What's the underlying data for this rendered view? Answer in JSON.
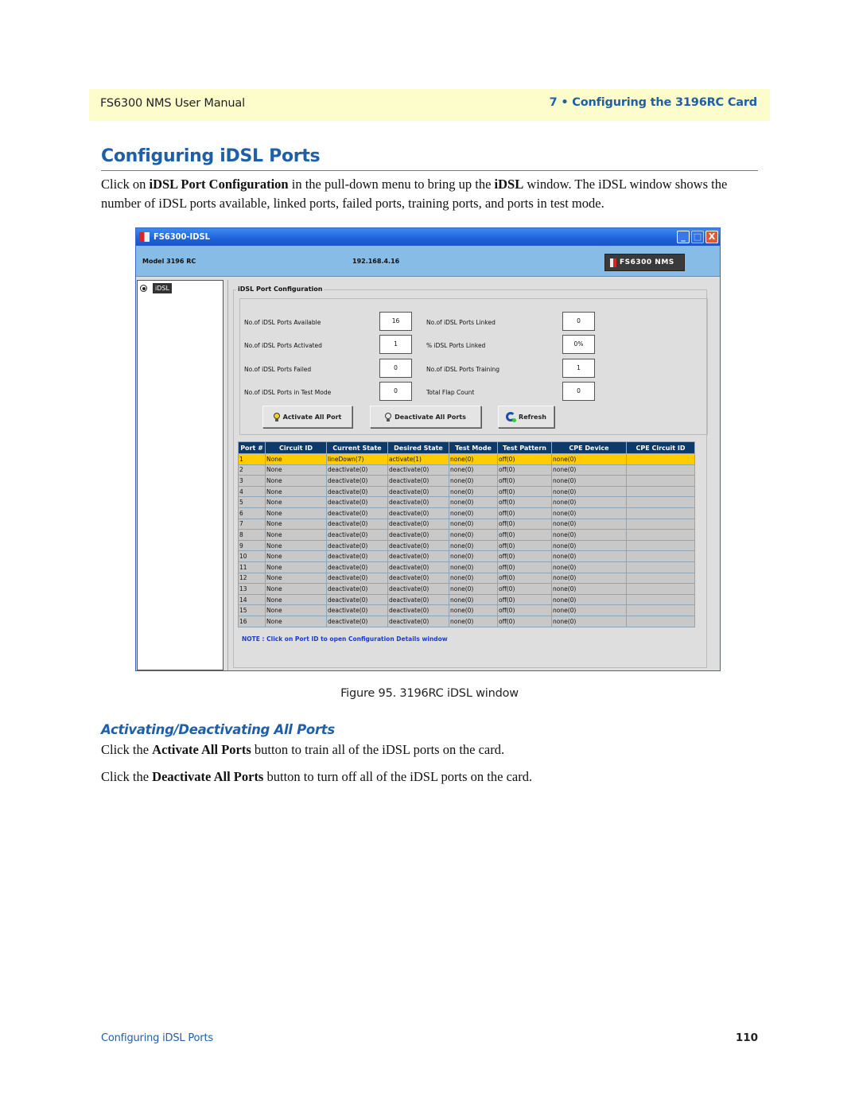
{
  "running_header": {
    "left": "FS6300 NMS User Manual",
    "right": "7 • Configuring the 3196RC Card"
  },
  "section": {
    "title": "Configuring iDSL Ports",
    "intro": {
      "t1": "Click on ",
      "b1": "iDSL Port Configuration",
      "t2": " in the pull-down menu to bring up the ",
      "b2": "iDSL",
      "t3": " window. The iDSL window shows the number of iDSL ports available, linked ports, failed ports, training ports, and ports in test mode."
    }
  },
  "window": {
    "title": "FS6300-IDSL",
    "controls": {
      "minimize": "_",
      "maximize": "□",
      "close": "X"
    },
    "info": {
      "model": "Model 3196 RC",
      "ip": "192.168.4.16",
      "brand": "FS6300 NMS"
    },
    "tree": {
      "node": "iDSL"
    },
    "group_title": "iDSL Port Configuration",
    "stats_left": [
      {
        "label": "No.of iDSL Ports Available",
        "value": "16"
      },
      {
        "label": "No.of iDSL Ports Activated",
        "value": "1"
      },
      {
        "label": "No.of iDSL Ports Failed",
        "value": "0"
      },
      {
        "label": "No.of iDSL Ports in Test Mode",
        "value": "0"
      }
    ],
    "stats_right": [
      {
        "label": "No.of iDSL Ports Linked",
        "value": "0"
      },
      {
        "label": "% iDSL Ports Linked",
        "value": "0%"
      },
      {
        "label": "No.of iDSL Ports Training",
        "value": "1"
      },
      {
        "label": "Total Flap Count",
        "value": "0"
      }
    ],
    "buttons": {
      "activate": "Activate All Port",
      "deactivate": "Deactivate All Ports",
      "refresh": "Refresh"
    },
    "table": {
      "columns": [
        "Port #",
        "Circuit ID",
        "Current State",
        "Desired State",
        "Test Mode",
        "Test Pattern",
        "CPE Device",
        "CPE Circuit ID"
      ],
      "rows": [
        [
          "1",
          "None",
          "lineDown(7)",
          "activate(1)",
          "none(0)",
          "off(0)",
          "none(0)",
          ""
        ],
        [
          "2",
          "None",
          "deactivate(0)",
          "deactivate(0)",
          "none(0)",
          "off(0)",
          "none(0)",
          ""
        ],
        [
          "3",
          "None",
          "deactivate(0)",
          "deactivate(0)",
          "none(0)",
          "off(0)",
          "none(0)",
          ""
        ],
        [
          "4",
          "None",
          "deactivate(0)",
          "deactivate(0)",
          "none(0)",
          "off(0)",
          "none(0)",
          ""
        ],
        [
          "5",
          "None",
          "deactivate(0)",
          "deactivate(0)",
          "none(0)",
          "off(0)",
          "none(0)",
          ""
        ],
        [
          "6",
          "None",
          "deactivate(0)",
          "deactivate(0)",
          "none(0)",
          "off(0)",
          "none(0)",
          ""
        ],
        [
          "7",
          "None",
          "deactivate(0)",
          "deactivate(0)",
          "none(0)",
          "off(0)",
          "none(0)",
          ""
        ],
        [
          "8",
          "None",
          "deactivate(0)",
          "deactivate(0)",
          "none(0)",
          "off(0)",
          "none(0)",
          ""
        ],
        [
          "9",
          "None",
          "deactivate(0)",
          "deactivate(0)",
          "none(0)",
          "off(0)",
          "none(0)",
          ""
        ],
        [
          "10",
          "None",
          "deactivate(0)",
          "deactivate(0)",
          "none(0)",
          "off(0)",
          "none(0)",
          ""
        ],
        [
          "11",
          "None",
          "deactivate(0)",
          "deactivate(0)",
          "none(0)",
          "off(0)",
          "none(0)",
          ""
        ],
        [
          "12",
          "None",
          "deactivate(0)",
          "deactivate(0)",
          "none(0)",
          "off(0)",
          "none(0)",
          ""
        ],
        [
          "13",
          "None",
          "deactivate(0)",
          "deactivate(0)",
          "none(0)",
          "off(0)",
          "none(0)",
          ""
        ],
        [
          "14",
          "None",
          "deactivate(0)",
          "deactivate(0)",
          "none(0)",
          "off(0)",
          "none(0)",
          ""
        ],
        [
          "15",
          "None",
          "deactivate(0)",
          "deactivate(0)",
          "none(0)",
          "off(0)",
          "none(0)",
          ""
        ],
        [
          "16",
          "None",
          "deactivate(0)",
          "deactivate(0)",
          "none(0)",
          "off(0)",
          "none(0)",
          ""
        ]
      ],
      "selected_row": 0
    },
    "note": "NOTE : Click on Port ID to open Configuration Details window"
  },
  "figure_caption": "Figure 95. 3196RC iDSL window",
  "subsection": {
    "title": "Activating/Deactivating All Ports",
    "p1": {
      "t1": "Click the ",
      "b1": "Activate All Ports",
      "t2": " button to train all of the iDSL ports on the card."
    },
    "p2": {
      "t1": "Click the ",
      "b1": "Deactivate All Ports",
      "t2": " button to turn off all of the iDSL ports on the card."
    }
  },
  "footer": {
    "left": "Configuring iDSL Ports",
    "page": "110"
  },
  "colors": {
    "heading_blue": "#1f5fa8",
    "header_band": "#fdfdcc",
    "table_header": "#0c3a6b",
    "selected_row": "#ffcc00",
    "note_blue": "#1b3bd0"
  }
}
